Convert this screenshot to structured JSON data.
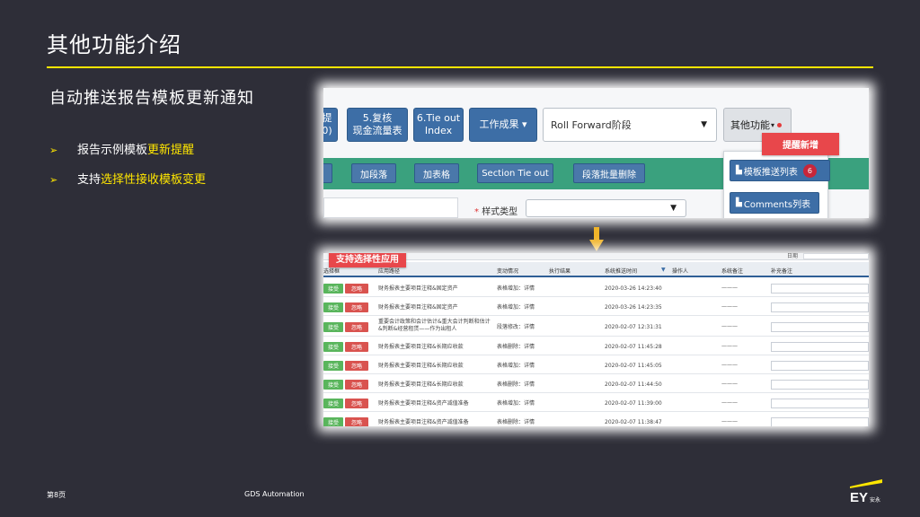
{
  "slide": {
    "title": "其他功能介绍",
    "subtitle": "自动推送报告模板更新通知",
    "bullets": [
      {
        "prefix": "报告示例模板",
        "highlight": "更新提醒",
        "suffix": ""
      },
      {
        "prefix": "支持",
        "highlight": "选择性接收模板变更",
        "suffix": ""
      }
    ],
    "footer_page": "第8页",
    "footer_center": "GDS Automation",
    "logo_text": "EY",
    "logo_sub": "安永",
    "colors": {
      "background": "#2e2e38",
      "accent": "#ffe600",
      "callout": "#e8474b"
    }
  },
  "screenshot1": {
    "btn_partial_line1": "提",
    "btn_partial_line2": "0)",
    "btn_recheck_line1": "5.复核",
    "btn_recheck_line2": "现金流量表",
    "btn_tieout_line1": "6.Tie out",
    "btn_tieout_line2": "Index",
    "work_result": "工作成果 ▾",
    "roll_forward": "Roll Forward阶段",
    "other_functions": "其他功能",
    "callout_new": "提醒新增",
    "toolbar": [
      "加段落",
      "加表格",
      "Section Tie out",
      "段落批量删除"
    ],
    "dropdown": {
      "template_list": "模板推送列表",
      "template_count": "6",
      "comments_list": "Comments列表"
    },
    "style_type_label": "样式类型",
    "required_mark": "*"
  },
  "screenshot2": {
    "callout_selective": "支持选择性应用",
    "top_label": "日期",
    "headers": [
      "选择框",
      "应用路径",
      "变动情况",
      "执行结果",
      "系统推送时间",
      "操作人",
      "系统备注",
      "补充备注"
    ],
    "accept": "接受",
    "ignore": "忽略",
    "dash": "———",
    "rows": [
      {
        "path": "财务报表主要项目注释&固定资产",
        "change": "表格增加：详情",
        "time": "2020-03-26 14:23:40"
      },
      {
        "path": "财务报表主要项目注释&固定资产",
        "change": "表格增加：详情",
        "time": "2020-03-26 14:23:35"
      },
      {
        "path": "重要会计政策和会计估计&重大会计判断和估计&判断&经营租赁——作为出租人",
        "change": "段落修改：详情",
        "time": "2020-02-07 12:31:31"
      },
      {
        "path": "财务报表主要项目注释&长期应收款",
        "change": "表格删除：详情",
        "time": "2020-02-07 11:45:28"
      },
      {
        "path": "财务报表主要项目注释&长期应收款",
        "change": "表格增加：详情",
        "time": "2020-02-07 11:45:05"
      },
      {
        "path": "财务报表主要项目注释&长期应收款",
        "change": "表格删除：详情",
        "time": "2020-02-07 11:44:50"
      },
      {
        "path": "财务报表主要项目注释&资产减值准备",
        "change": "表格增加：详情",
        "time": "2020-02-07 11:39:00"
      },
      {
        "path": "财务报表主要项目注释&资产减值准备",
        "change": "表格删除：详情",
        "time": "2020-02-07 11:38:47"
      }
    ]
  }
}
